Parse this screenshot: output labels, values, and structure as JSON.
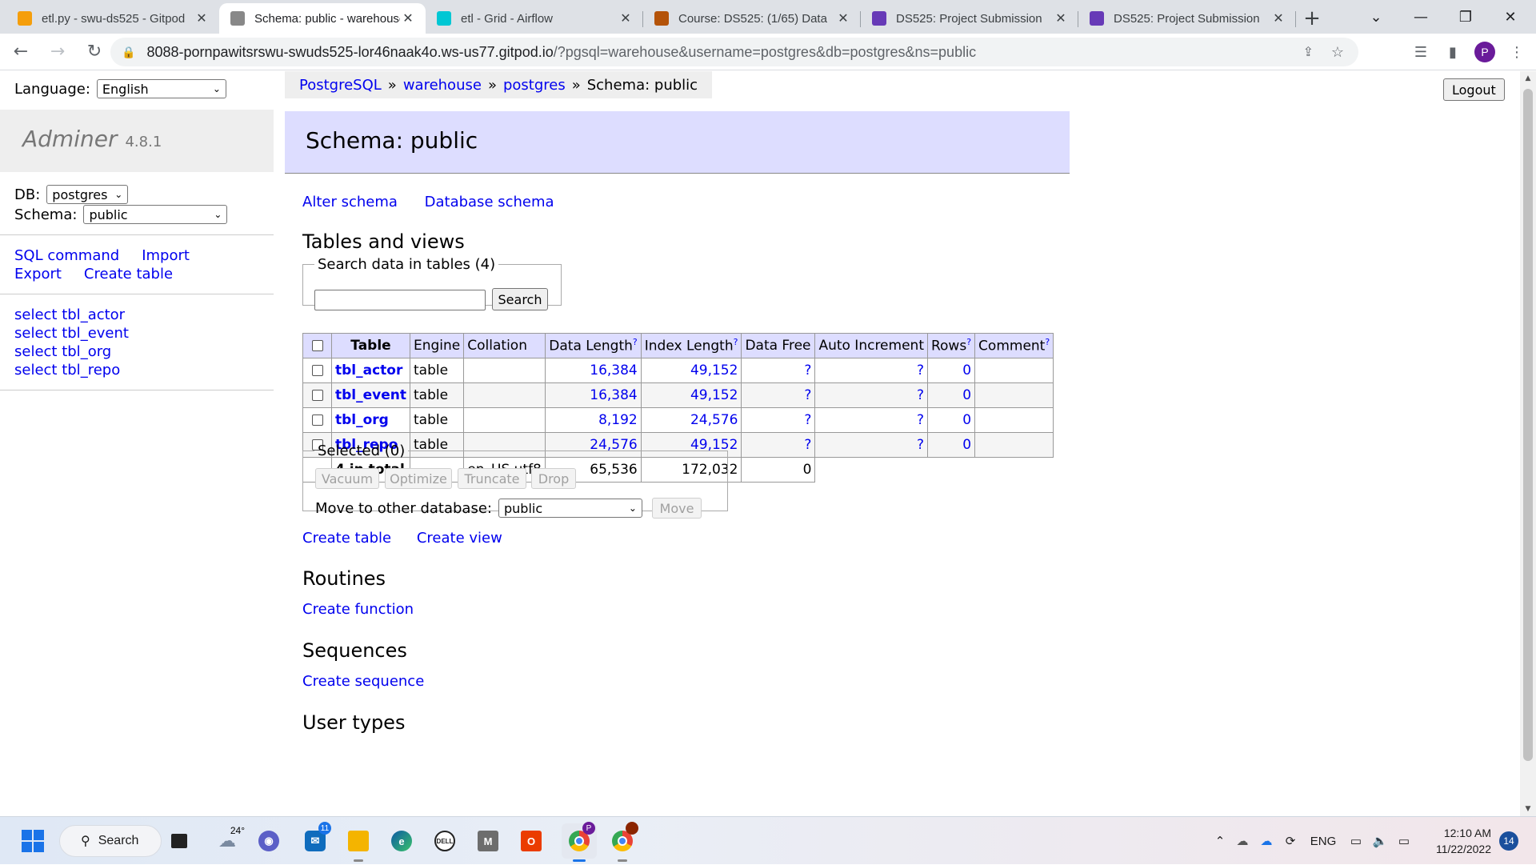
{
  "browser": {
    "tabs": [
      {
        "title": "etl.py - swu-ds525 - Gitpod",
        "favicon_color": "#f59e0b",
        "favicon": "gitpod-icon"
      },
      {
        "title": "Schema: public - warehouse",
        "favicon_color": "#888888",
        "favicon": "adminer-icon",
        "active": true
      },
      {
        "title": "etl - Grid - Airflow",
        "favicon_color": "#00c7d4",
        "favicon": "airflow-icon"
      },
      {
        "title": "Course: DS525: (1/65) Data",
        "favicon_color": "#b45309",
        "favicon": "moodle-icon"
      },
      {
        "title": "DS525: Project Submission",
        "favicon_color": "#673ab7",
        "favicon": "forms-icon"
      },
      {
        "title": "DS525: Project Submission",
        "favicon_color": "#673ab7",
        "favicon": "forms-icon"
      }
    ],
    "url_host": "8088-pornpawitsrswu-swuds525-lor46naak4o.ws-us77.gitpod.io",
    "url_rest": "/?pgsql=warehouse&username=postgres&db=postgres&ns=public",
    "profile_initial": "P"
  },
  "sidebar": {
    "language_label": "Language:",
    "language_value": "English",
    "app_name": "Adminer",
    "app_version": "4.8.1",
    "db_label": "DB:",
    "db_value": "postgres",
    "schema_label": "Schema:",
    "schema_value": "public",
    "links": {
      "sql_command": "SQL command",
      "import": "Import",
      "export": "Export",
      "create_table": "Create table"
    },
    "tables": [
      "select tbl_actor",
      "select tbl_event",
      "select tbl_org",
      "select tbl_repo"
    ]
  },
  "breadcrumb": {
    "driver": "PostgreSQL",
    "server": "warehouse",
    "db": "postgres",
    "current": "Schema: public",
    "sep": "»"
  },
  "logout_label": "Logout",
  "page": {
    "title": "Schema: public",
    "alter_schema": "Alter schema",
    "database_schema": "Database schema",
    "tables_heading": "Tables and views",
    "search_legend": "Search data in tables (4)",
    "search_value": "",
    "search_button": "Search",
    "columns": [
      "Table",
      "Engine",
      "Collation",
      "Data Length",
      "Index Length",
      "Data Free",
      "Auto Increment",
      "Rows",
      "Comment"
    ],
    "rows": [
      {
        "name": "tbl_actor",
        "engine": "table",
        "collation": "",
        "data_length": "16,384",
        "index_length": "49,152",
        "data_free": "?",
        "auto_increment": "?",
        "rows": "0",
        "comment": ""
      },
      {
        "name": "tbl_event",
        "engine": "table",
        "collation": "",
        "data_length": "16,384",
        "index_length": "49,152",
        "data_free": "?",
        "auto_increment": "?",
        "rows": "0",
        "comment": ""
      },
      {
        "name": "tbl_org",
        "engine": "table",
        "collation": "",
        "data_length": "8,192",
        "index_length": "24,576",
        "data_free": "?",
        "auto_increment": "?",
        "rows": "0",
        "comment": ""
      },
      {
        "name": "tbl_repo",
        "engine": "table",
        "collation": "",
        "data_length": "24,576",
        "index_length": "49,152",
        "data_free": "?",
        "auto_increment": "?",
        "rows": "0",
        "comment": ""
      }
    ],
    "total": {
      "label": "4 in total",
      "collation": "en_US.utf8",
      "data_length": "65,536",
      "index_length": "172,032",
      "data_free": "0"
    },
    "help_mark": "?",
    "selected_legend": "Selected (0)",
    "actions": [
      "Vacuum",
      "Optimize",
      "Truncate",
      "Drop"
    ],
    "move_label": "Move to other database:",
    "move_value": "public",
    "move_button": "Move",
    "create_table": "Create table",
    "create_view": "Create view",
    "routines_heading": "Routines",
    "create_function": "Create function",
    "sequences_heading": "Sequences",
    "create_sequence": "Create sequence",
    "user_types_heading": "User types"
  },
  "taskbar": {
    "search_label": "Search",
    "weather_temp": "24°",
    "mail_badge": "11",
    "chrome_profile_badge": "P",
    "lang": "ENG",
    "time": "12:10 AM",
    "date": "11/22/2022",
    "notifications": "14"
  }
}
